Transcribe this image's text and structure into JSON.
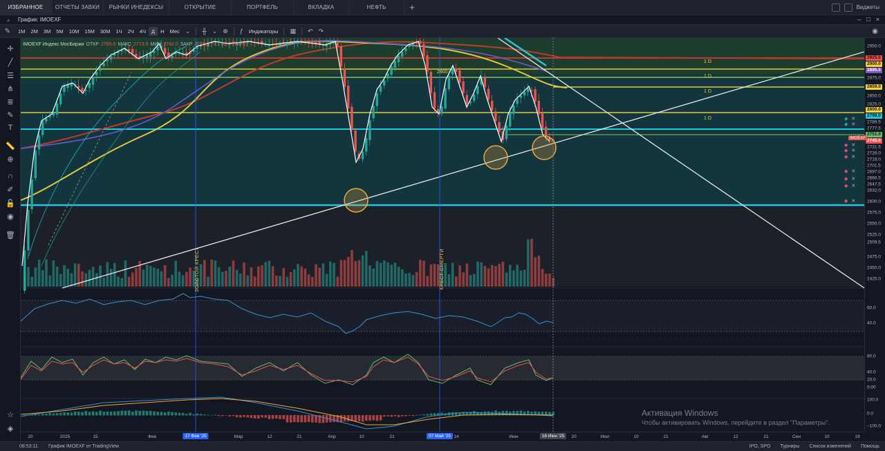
{
  "tabs": [
    {
      "label": "Избранное",
      "active": true
    },
    {
      "label": "ОТЧЕТЫ ЗАВКИ"
    },
    {
      "label": "РЫНКИ ИНЕДЕКСЫ"
    },
    {
      "label": "ОТКРЫТИЕ"
    },
    {
      "label": "ПОРТФЕЛЬ"
    },
    {
      "label": "Вкладка"
    },
    {
      "label": "НЕФТЬ"
    }
  ],
  "widgets_label": "Виджеты",
  "chart_title": "График: IMOEXF",
  "timeframes": [
    "1М",
    "2М",
    "3М",
    "5М",
    "10М",
    "15М",
    "30М",
    "1Ч",
    "2Ч",
    "4Ч",
    "Д",
    "Н",
    "Мес"
  ],
  "active_timeframe": "Д",
  "indicators_label": "Индикаторы",
  "legend": {
    "symbol": "IMOEXF Индекс МосБиржи",
    "open_key": "ОТКР",
    "open_val": "2765.0",
    "high_key": "МАКС",
    "high_val": "2773.0",
    "low_key": "МИН",
    "low_val": "2742.0",
    "close_key": "ЗАКР",
    "close_val": "2745.0",
    "change_val": "−17.00 (−0.62%)"
  },
  "price_labels": [
    "2950.0",
    "2875.0",
    "2850.0",
    "2825.0",
    "2775.0",
    "2750.0",
    "2725.0",
    "2700.0",
    "2675.0",
    "2650.0",
    "2625.0",
    "2600.0",
    "2575.0",
    "2550.0",
    "2525.0",
    "2500.0",
    "2475.0",
    "2450.0",
    "2425.0"
  ],
  "price_tags": [
    {
      "label": "2925.0",
      "color": "#ef5350"
    },
    {
      "label": "2900.0",
      "color": "#f4d03f"
    },
    {
      "label": "2895.5",
      "color": "#7e57c2"
    },
    {
      "label": "2859.0",
      "color": "#f4d03f"
    },
    {
      "label": "2800.0",
      "color": "#f4d03f"
    },
    {
      "label": "2799.0",
      "color": "#26c6da"
    },
    {
      "label": "2789.5",
      "color": ""
    },
    {
      "label": "2777.5",
      "color": ""
    },
    {
      "label": "2751.0",
      "color": "#66bb6a"
    },
    {
      "label": "2745.0",
      "color": "#ef5350"
    },
    {
      "label": "2731.5",
      "color": ""
    },
    {
      "label": "2726.0",
      "color": ""
    },
    {
      "label": "2718.0",
      "color": ""
    },
    {
      "label": "2701.5",
      "color": ""
    },
    {
      "label": "2697.0",
      "color": ""
    },
    {
      "label": "2666.5",
      "color": ""
    },
    {
      "label": "2647.5",
      "color": ""
    },
    {
      "label": "2632.0",
      "color": ""
    },
    {
      "label": "2600.0",
      "color": ""
    },
    {
      "label": "2509.5",
      "color": ""
    }
  ],
  "price_tag_badge": "IMOEXF",
  "indicator_labels": {
    "rsi": [
      "60.0",
      "40.0"
    ],
    "stoch": [
      "80.0",
      "40.0",
      "20.0",
      "0.00"
    ],
    "macd": [
      "100.0",
      "0.0",
      "−100.0"
    ]
  },
  "level_labels": [
    "1 D",
    "1 D",
    "1 D",
    "1 D"
  ],
  "price_level_2900": "2900",
  "cross_labels": {
    "golden": "ЗОЛОТОЙ КРЕСТ",
    "death": "КРЕСТ СМЕРТИ"
  },
  "time_labels": [
    "20",
    "2025",
    "15",
    "Фев",
    "Мар",
    "12",
    "21",
    "Апр",
    "10",
    "21",
    "14",
    "Июн",
    "20",
    "Июл",
    "10",
    "21",
    "Авг",
    "12",
    "21",
    "Сен",
    "10",
    "19"
  ],
  "time_marks": {
    "golden": "17 Фев '25",
    "death": "07 Май '25",
    "current": "16 Июн '25"
  },
  "status": {
    "time": "08:53:11",
    "chart": "График IMOEXF от TradingView",
    "items": [
      "IPO, SPO",
      "Турниры",
      "Список изменений",
      "Помощь"
    ]
  },
  "watermark": {
    "title": "Активация Windows",
    "text": "Чтобы активировать Windows, перейдите в раздел \"Параметры\"."
  },
  "colors": {
    "up": "#26a69a",
    "down": "#ef5350",
    "ma_yellow": "#e2c93a",
    "ma_red": "#c0392b",
    "ma_purple": "#6a5acd",
    "level_cyan": "#26c6da",
    "level_green": "#8bc34a",
    "circle": "#f1a93a"
  }
}
